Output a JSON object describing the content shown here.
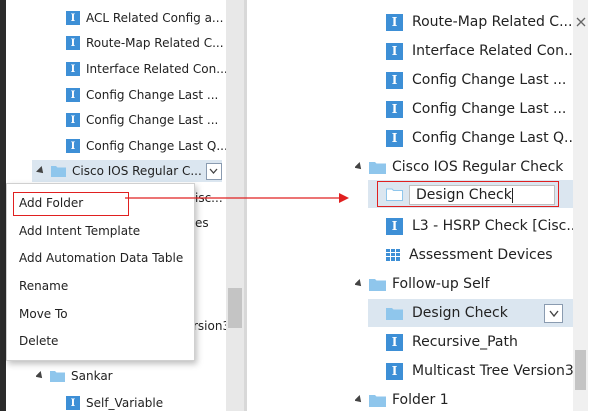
{
  "left_tree": {
    "items": [
      {
        "label": "ACL Related Config a..."
      },
      {
        "label": "Route-Map Related C..."
      },
      {
        "label": "Interface Related Con..."
      },
      {
        "label": "Config Change Last ..."
      },
      {
        "label": "Config Change Last ..."
      },
      {
        "label": "Config Change Last Q..."
      }
    ],
    "selected_folder": "Cisco IOS Regular C...",
    "behind_menu_fragments": [
      "isc...",
      "es",
      "rsion3"
    ],
    "sankar": "Sankar",
    "self_variable": "Self_Variable"
  },
  "context_menu": {
    "items": [
      {
        "label": "Add Folder"
      },
      {
        "label": "Add Intent Template"
      },
      {
        "label": "Add Automation Data Table"
      },
      {
        "label": "Rename"
      },
      {
        "label": "Move To"
      },
      {
        "label": "Delete"
      }
    ],
    "highlighted": "Add Folder"
  },
  "right_tree": {
    "items": [
      {
        "label": "Route-Map Related C..."
      },
      {
        "label": "Interface Related Con..."
      },
      {
        "label": "Config Change Last ..."
      },
      {
        "label": "Config Change Last ..."
      },
      {
        "label": "Config Change Last Q..."
      }
    ],
    "cisco_folder": "Cisco IOS Regular Check",
    "new_folder_input_value": "Design Check",
    "l3_item": "L3 - HSRP Check [Cisc...",
    "assessment_item": "Assessment Devices",
    "followup_folder": "Follow-up Self",
    "design_check": "Design Check",
    "recursive_path": "Recursive_Path",
    "multicast": "Multicast Tree Version3",
    "folder1": "Folder 1"
  },
  "colors": {
    "accent": "#3d8fd6",
    "folder": "#8fc6ec",
    "highlight_border": "#e02020",
    "selected_bg": "#dbe6f0",
    "arrow": "#e02020"
  },
  "icons": {
    "intent": "intent-icon",
    "folder": "folder-icon",
    "table": "data-table-icon",
    "chevron": "chevron-down-icon",
    "expand": "expand-triangle-icon"
  }
}
